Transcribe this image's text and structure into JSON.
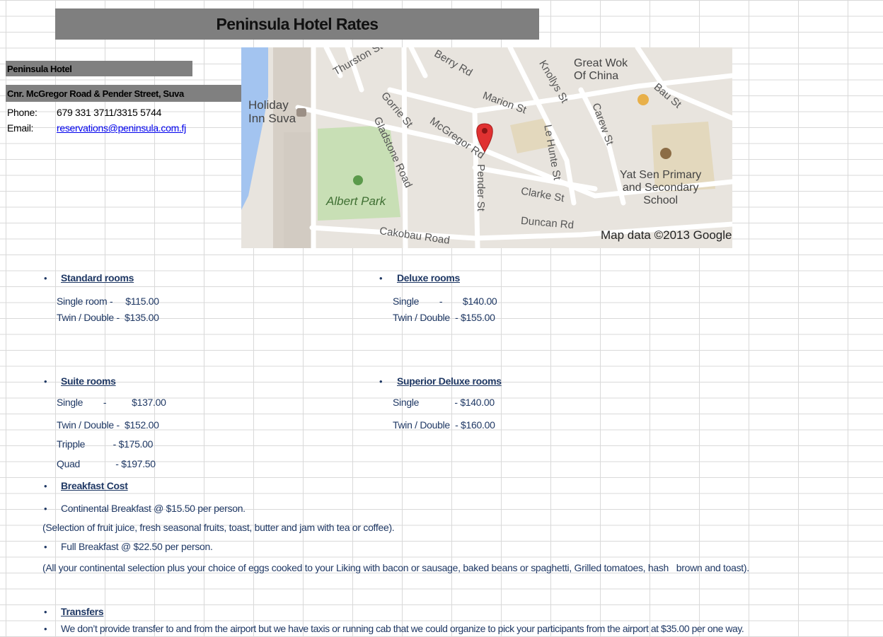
{
  "title": "Peninsula Hotel Rates",
  "hotel": {
    "name": "Peninsula Hotel",
    "address": "Cnr. McGregor Road & Pender Street, Suva",
    "phone_label": "Phone:",
    "phone_value": "679 331 3711/3315 5744",
    "email_label": "Email:",
    "email_value": "reservations@peninsula.com.fj"
  },
  "map": {
    "labels": {
      "thurston": "Thurston St",
      "berry": "Berry Rd",
      "knollys": "Knollys St",
      "great_wok": "Great Wok\nOf China",
      "holiday_inn": "Holiday\nInn Suva",
      "gorrie": "Gorrie St",
      "marion": "Marion St",
      "carew": "Carew St",
      "bau": "Bau St",
      "mcgregor": "McGregor Rd",
      "gladstone": "Gladstone Road",
      "le_hunte": "Le Hunte St",
      "yat_sen": "Yat Sen Primary\nand Secondary\nSchool",
      "albert_park": "Albert Park",
      "pender": "Pender St",
      "clarke": "Clarke St",
      "duncan": "Duncan Rd",
      "cakobau": "Cakobau Road",
      "copyright": "Map data ©2013 Google"
    },
    "colors": {
      "water": "#a3c4f0",
      "park": "#c8dfb5",
      "road": "#ffffff",
      "block": "#d6cfc6",
      "land": "#e8e4de",
      "pin": "#e03131"
    }
  },
  "standard": {
    "heading": "Standard rooms",
    "line1": "Single room -     $115.00",
    "line2": "Twin / Double -  $135.00"
  },
  "deluxe": {
    "heading": "Deluxe rooms",
    "line1": "Single        -        $140.00",
    "line2": "Twin / Double  - $155.00"
  },
  "suite": {
    "heading": "Suite rooms",
    "line1": "Single        -          $137.00",
    "line2": "Twin / Double -  $152.00",
    "line3": "Tripple           - $175.00",
    "line4": "Quad              - $197.50"
  },
  "superior": {
    "heading": "Superior Deluxe rooms",
    "line1": "Single              - $140.00",
    "line2": "Twin / Double  - $160.00"
  },
  "breakfast": {
    "heading": "Breakfast Cost",
    "continental": "Continental Breakfast @ $15.50 per person.",
    "continental_note": "(Selection of fruit juice, fresh seasonal fruits, toast, butter and jam with  tea or coffee).",
    "full": "Full Breakfast @ $22.50 per person.",
    "full_note": "(All your continental selection plus your choice of eggs cooked to your Liking with bacon or sausage, baked beans or spaghetti, Grilled tomatoes, hash   brown and toast)."
  },
  "transfers": {
    "heading": "Transfers",
    "text": "We don’t provide transfer to and from the airport but we have taxis or running cab that we could organize to pick your participants from the airport at $35.00 per one way."
  },
  "bullet_char": "•"
}
